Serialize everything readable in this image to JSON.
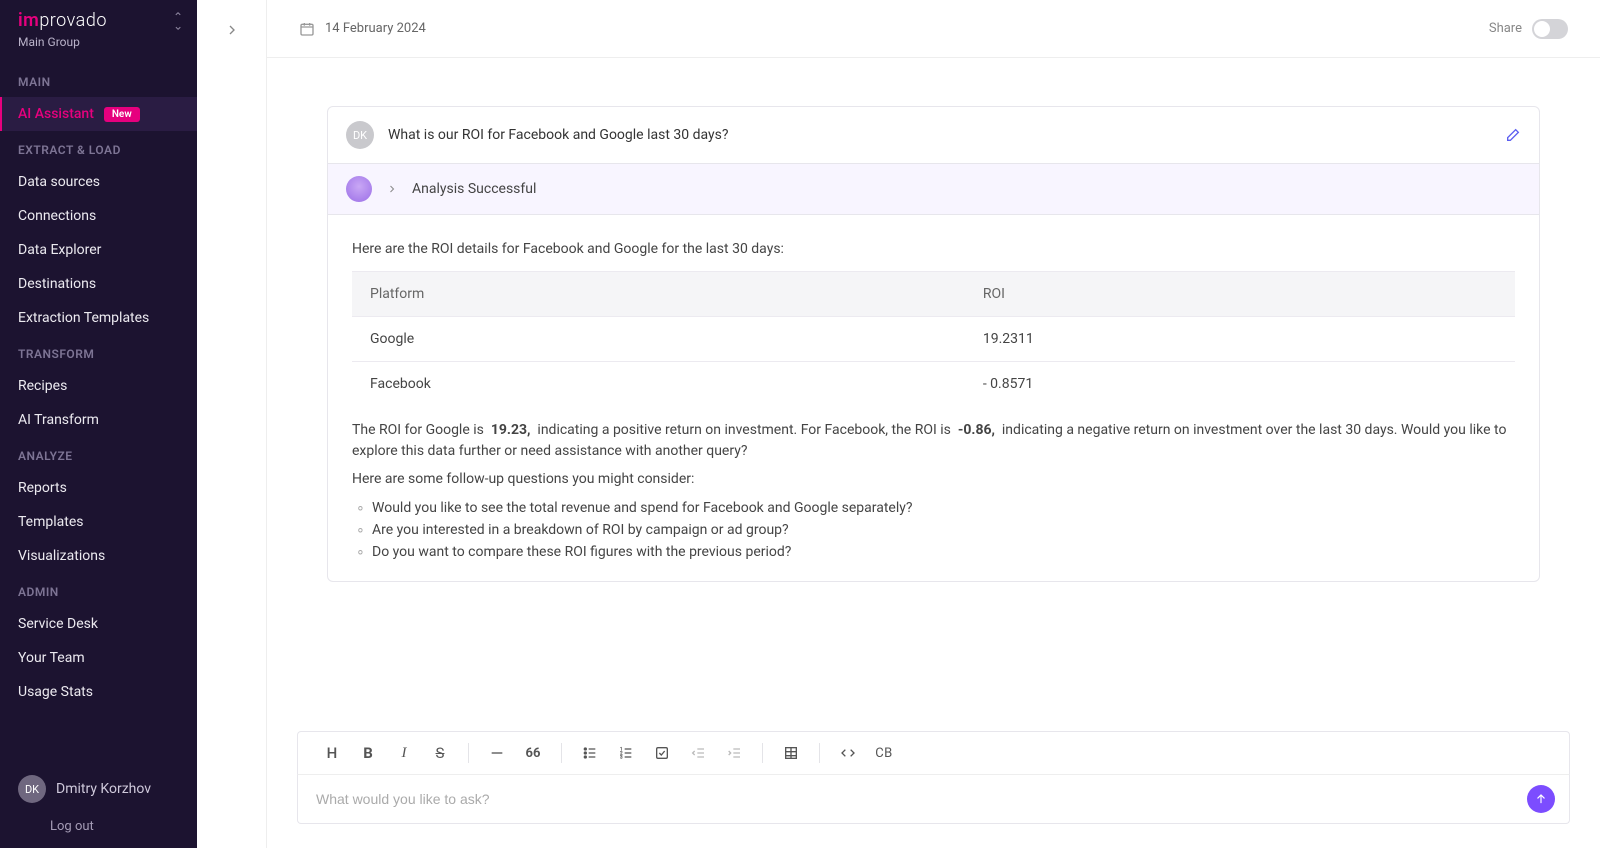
{
  "brand": {
    "prefix": "im",
    "rest": "provado"
  },
  "group": "Main Group",
  "sections": {
    "main": {
      "header": "MAIN",
      "items": [
        {
          "label": "AI Assistant",
          "badge": "New"
        }
      ]
    },
    "extract": {
      "header": "EXTRACT & LOAD",
      "items": [
        {
          "label": "Data sources"
        },
        {
          "label": "Connections"
        },
        {
          "label": "Data Explorer"
        },
        {
          "label": "Destinations"
        },
        {
          "label": "Extraction Templates"
        }
      ]
    },
    "transform": {
      "header": "TRANSFORM",
      "items": [
        {
          "label": "Recipes"
        },
        {
          "label": "AI Transform"
        }
      ]
    },
    "analyze": {
      "header": "ANALYZE",
      "items": [
        {
          "label": "Reports"
        },
        {
          "label": "Templates"
        },
        {
          "label": "Visualizations"
        }
      ]
    },
    "admin": {
      "header": "ADMIN",
      "items": [
        {
          "label": "Service Desk"
        },
        {
          "label": "Your Team"
        },
        {
          "label": "Usage Stats"
        }
      ]
    }
  },
  "user": {
    "initials": "DK",
    "name": "Dmitry Korzhov",
    "logout": "Log out"
  },
  "topbar": {
    "date": "14 February 2024",
    "share": "Share"
  },
  "chat": {
    "user_initials": "DK",
    "question": "What is our ROI for Facebook and Google last 30 days?",
    "status": "Analysis Successful",
    "intro": "Here are the ROI details for Facebook and Google for the last 30 days:",
    "table": {
      "headers": {
        "platform": "Platform",
        "roi": "ROI"
      },
      "rows": [
        {
          "platform": "Google",
          "roi": "19.2311"
        },
        {
          "platform": "Facebook",
          "roi": "- 0.8571"
        }
      ]
    },
    "summary_pre": "The ROI for Google is",
    "summary_g": "19.23,",
    "summary_mid": "indicating a positive return on investment. For Facebook, the ROI is",
    "summary_f": "-0.86,",
    "summary_post": "indicating a negative return on investment over the last 30 days. Would you like to explore this data further or need assistance with another query?",
    "followup_intro": "Here are some follow-up questions you might consider:",
    "followups": [
      "Would you like to see the total revenue and spend for Facebook and Google separately?",
      "Are you interested in a breakdown of ROI by campaign or ad group?",
      "Do you want to compare these ROI figures with the previous period?"
    ]
  },
  "composer": {
    "placeholder": "What would you like to ask?"
  }
}
